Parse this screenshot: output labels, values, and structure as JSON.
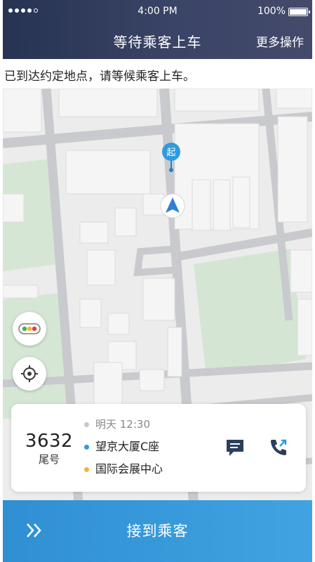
{
  "status_bar": {
    "time": "4:00 PM",
    "battery": "100%"
  },
  "header": {
    "title": "等待乘客上车",
    "more_label": "更多操作"
  },
  "notice": "已到达约定地点，请等候乘客上车。",
  "map": {
    "start_marker_label": "起"
  },
  "order_card": {
    "tail_number": "3632",
    "tail_label": "尾号",
    "time": "明天 12:30",
    "pickup": "望京大厦C座",
    "destination": "国际会展中心"
  },
  "action_button": {
    "label": "接到乘客"
  },
  "colors": {
    "header": "#2b3556",
    "action": "#3498da",
    "pickup_dot": "#2e9be0",
    "destination_dot": "#f2b53a",
    "time_dot": "#c8c8c8",
    "icon": "#2c3e5c"
  },
  "icons": {
    "chat": "chat-icon",
    "phone": "phone-icon",
    "traffic": "traffic-light-icon",
    "locate": "locate-icon",
    "navigation": "navigation-arrow-icon"
  }
}
